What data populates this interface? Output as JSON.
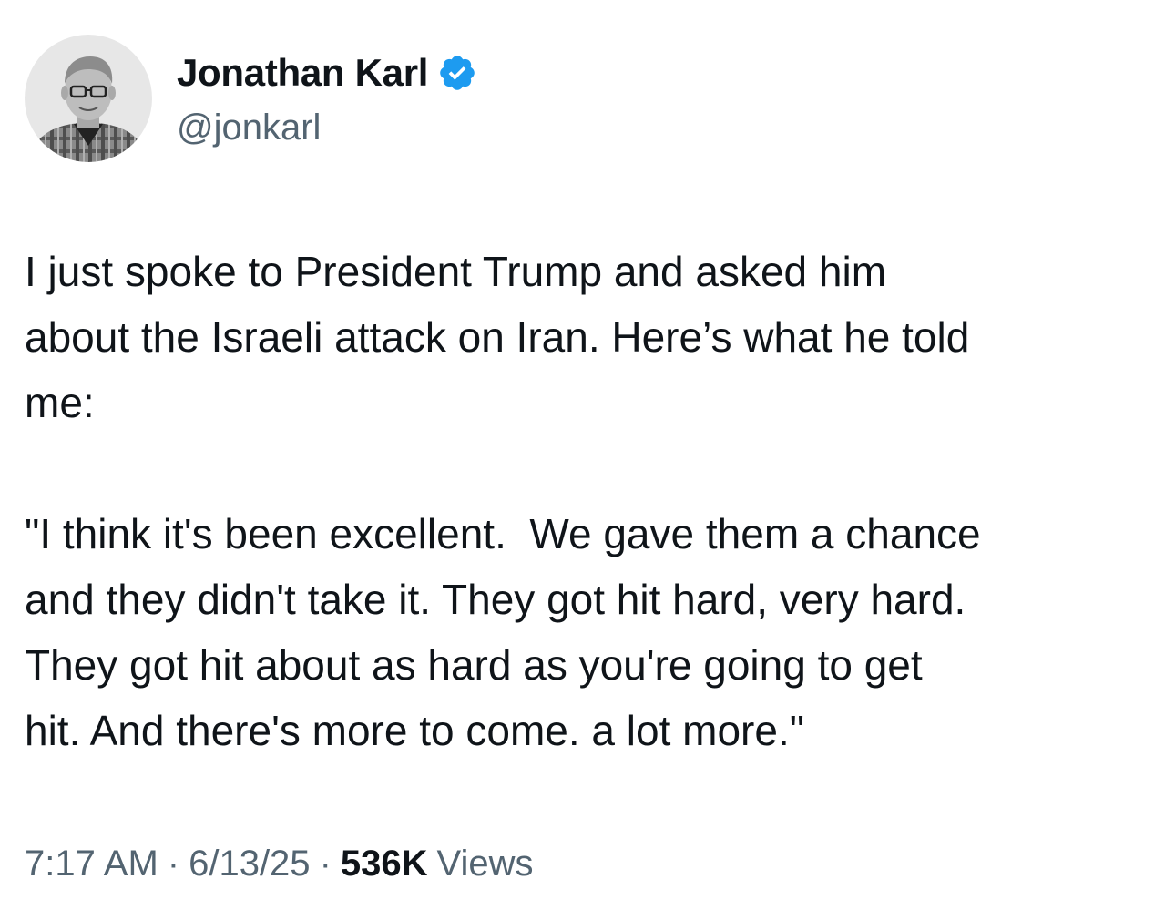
{
  "author": {
    "display_name": "Jonathan Karl",
    "handle": "@jonkarl",
    "verified": true,
    "verified_badge_color": "#1d9bf0"
  },
  "tweet": {
    "text": "I just spoke to President Trump and asked him\nabout the Israeli attack on Iran. Here’s what he told\nme:\n\n\"I think it's been excellent.  We gave them a chance\nand they didn't take it. They got hit hard, very hard.\nThey got hit about as hard as you're going to get\nhit. And there's more to come. a lot more.\"",
    "time": "7:17 AM",
    "date": "6/13/25",
    "separator": "·",
    "views_count": "536K",
    "views_label": "Views"
  },
  "colors": {
    "text_primary": "#0f1419",
    "text_secondary": "#536471",
    "accent": "#1d9bf0"
  },
  "icons": {
    "verified": "verified-badge-icon",
    "avatar": "avatar-photo"
  }
}
